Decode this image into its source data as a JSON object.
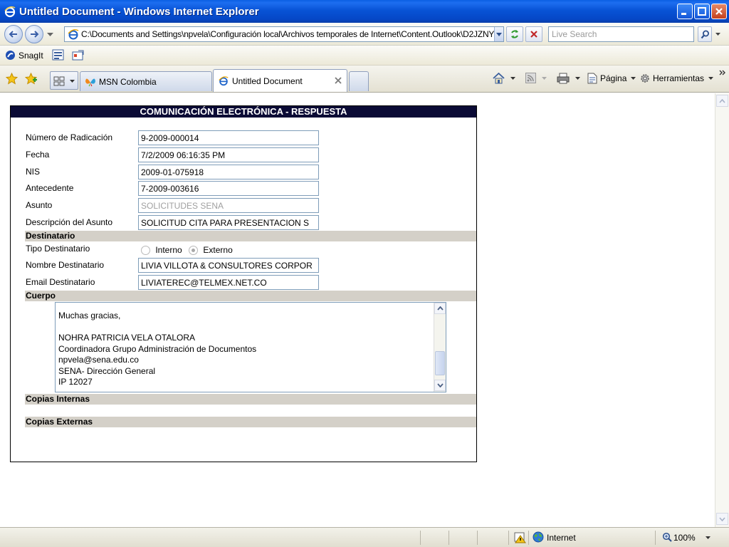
{
  "window": {
    "title": "Untitled Document - Windows Internet Explorer"
  },
  "addressbar": {
    "url": "C:\\Documents and Settings\\npvela\\Configuración local\\Archivos temporales de Internet\\Content.Outlook\\D2JZNY",
    "search_placeholder": "Live Search"
  },
  "links": {
    "snagit": "SnagIt"
  },
  "tabs": [
    {
      "label": "MSN Colombia"
    },
    {
      "label": "Untitled Document"
    }
  ],
  "toolbar": {
    "page": "Página",
    "tools": "Herramientas"
  },
  "form": {
    "heading": "COMUNICACIÓN ELECTRÓNICA - RESPUESTA",
    "fields": [
      {
        "label": "Número de Radicación",
        "value": "9-2009-000014"
      },
      {
        "label": "Fecha",
        "value": "7/2/2009 06:16:35 PM"
      },
      {
        "label": "NIS",
        "value": "2009-01-075918"
      },
      {
        "label": "Antecedente",
        "value": "7-2009-003616"
      },
      {
        "label": "Asunto",
        "value": "SOLICITUDES SENA"
      },
      {
        "label": "Descripción del Asunto",
        "value": "SOLICITUD CITA PARA PRESENTACION S"
      }
    ],
    "section_destinatario": "Destinatario",
    "tipo_label": "Tipo Destinatario",
    "tipo_options": [
      "Interno",
      "Externo"
    ],
    "tipo_selected": "Externo",
    "nombre_label": "Nombre Destinatario",
    "nombre_value": "LIVIA VILLOTA & CONSULTORES CORPOR",
    "email_label": "Email Destinatario",
    "email_value": "LIVIATEREC@TELMEX.NET.CO",
    "section_cuerpo": "Cuerpo",
    "cuerpo_lines": [
      "Muchas gracias,",
      "",
      "NOHRA PATRICIA VELA OTALORA",
      "Coordinadora Grupo Administración de Documentos",
      "npvela@sena.edu.co",
      "SENA- Dirección General",
      "IP 12027"
    ],
    "section_internas": "Copias Internas",
    "section_externas": "Copias Externas"
  },
  "status": {
    "zone": "Internet",
    "zoom": "100%"
  },
  "colors": {
    "title_bar": "#0853d6",
    "form_header": "#0a0a35",
    "section_bg": "#d4d0c8"
  }
}
